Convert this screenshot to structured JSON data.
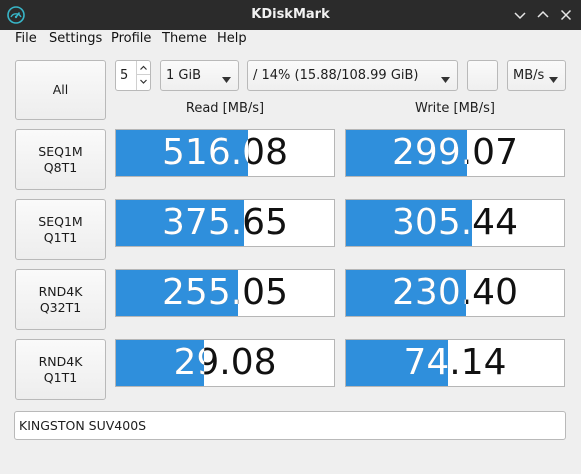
{
  "window": {
    "title": "KDiskMark"
  },
  "menu": [
    "File",
    "Settings",
    "Profile",
    "Theme",
    "Help"
  ],
  "controls": {
    "all_label": "All",
    "loops": "5",
    "size": "1 GiB",
    "target": "/ 14% (15.88/108.99 GiB)",
    "unit": "MB/s"
  },
  "columns": {
    "read": "Read [MB/s]",
    "write": "Write [MB/s]"
  },
  "tests": [
    {
      "line1": "SEQ1M",
      "line2": "Q8T1",
      "read": "516.08",
      "write": "299.07",
      "read_fraction": 0.606,
      "write_fraction": 0.555
    },
    {
      "line1": "SEQ1M",
      "line2": "Q1T1",
      "read": "375.65",
      "write": "305.44",
      "read_fraction": 0.586,
      "write_fraction": 0.577
    },
    {
      "line1": "RND4K",
      "line2": "Q32T1",
      "read": "255.05",
      "write": "230.40",
      "read_fraction": 0.559,
      "write_fraction": 0.55
    },
    {
      "line1": "RND4K",
      "line2": "Q1T1",
      "read": "29.08",
      "write": "74.14",
      "read_fraction": 0.405,
      "write_fraction": 0.468
    }
  ],
  "device": "KINGSTON SUV400S",
  "colors": {
    "bar_fill": "#2f8fdc",
    "titlebar": "#2b2b2b"
  }
}
